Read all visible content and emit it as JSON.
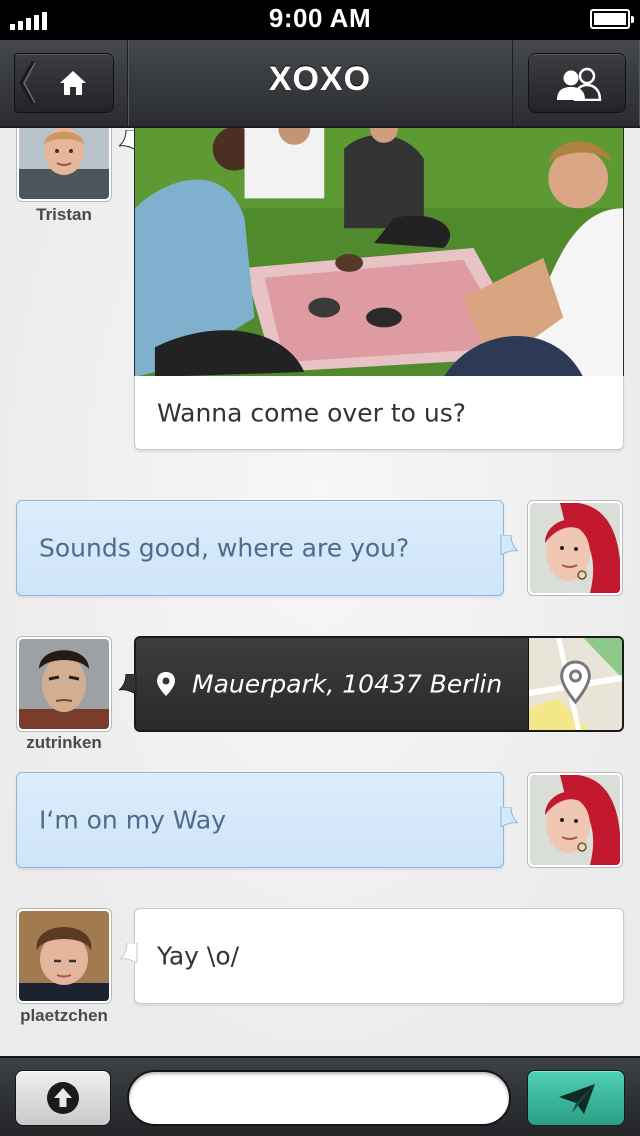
{
  "status_bar": {
    "time": "9:00 AM"
  },
  "nav": {
    "title": "XOXO",
    "back_icon": "chevron-left-icon",
    "home_icon": "home-icon",
    "contacts_icon": "group-icon"
  },
  "messages": [
    {
      "sender": "Tristan",
      "side": "left",
      "type": "photo",
      "text": "Wanna come over to us?"
    },
    {
      "sender": "me",
      "side": "right",
      "type": "text",
      "text": "Sounds good, where are you?"
    },
    {
      "sender": "zutrinken",
      "side": "left",
      "type": "location",
      "text": "Mauerpark, 10437 Berlin"
    },
    {
      "sender": "me",
      "side": "right",
      "type": "text",
      "text": "I‘m on my Way"
    },
    {
      "sender": "plaetzchen",
      "side": "left",
      "type": "text",
      "text": "Yay \\o/"
    }
  ],
  "composer": {
    "value": "",
    "placeholder": "",
    "attach_icon": "upload-arrow-icon",
    "send_icon": "paper-plane-icon"
  },
  "colors": {
    "nav_dark": "#2b2d30",
    "bubble_blue": "#d6e9fa",
    "bubble_blue_text": "#4a6d8c",
    "send_teal": "#3cba9c"
  }
}
